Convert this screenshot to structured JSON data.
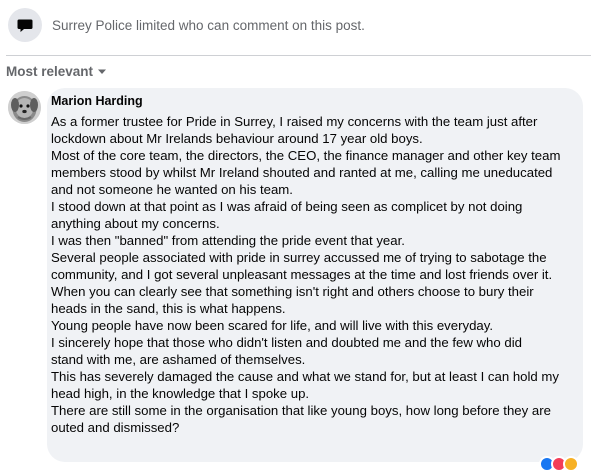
{
  "notice": {
    "icon": "comment-icon",
    "text": "Surrey Police limited who can comment on this post."
  },
  "sort": {
    "label": "Most relevant",
    "icon": "caret-down-icon"
  },
  "comment": {
    "author": "Marion Harding",
    "avatar": "dog-avatar",
    "lines": [
      "As a former trustee for Pride in Surrey, I raised my concerns with the team just after",
      "lockdown about Mr Irelands behaviour around 17 year old boys.",
      "Most of the core team, the directors, the CEO, the finance manager and other key team",
      "members stood by whilst Mr Ireland shouted and ranted at me, calling me uneducated",
      "and not someone he wanted on his team.",
      "I stood down at that point as I was afraid of being seen as complicet by not doing",
      "anything about my concerns.",
      "I was then \"banned\" from attending the pride event that year.",
      "Several people associated with pride in surrey accussed me of trying to sabotage the",
      "community, and I got several unpleasant messages at the time and lost friends over it.",
      "When you can clearly see that something isn't right and others choose to bury their",
      "heads in the sand, this is what happens.",
      "Young people have now been scared for life, and will live with this everyday.",
      "I sincerely hope that those who didn't listen and doubted me and the few who did",
      "stand with me, are ashamed of themselves.",
      "This has severely damaged the cause and what we stand for, but at least I can hold my",
      "head high, in the knowledge that I spoke up.",
      "There are still some in the organisation that like young boys, how long before they are",
      "outed and dismissed?"
    ],
    "reactions": [
      "like-icon",
      "love-icon",
      "care-icon"
    ]
  },
  "colors": {
    "bubble": "#f0f2f5",
    "secondary_text": "#65676b",
    "divider": "#ced0d4"
  }
}
